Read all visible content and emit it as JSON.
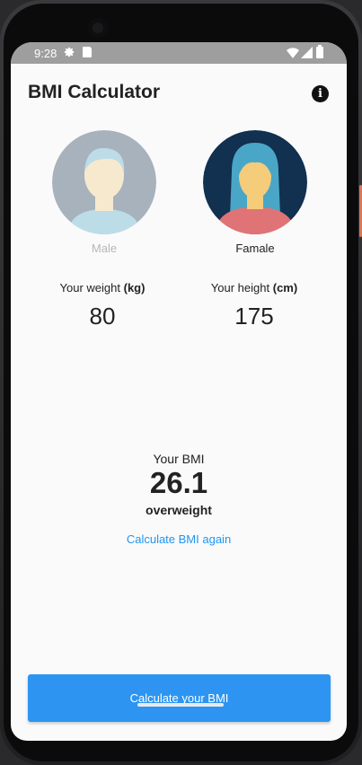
{
  "statusbar": {
    "time": "9:28",
    "icons": [
      "gear-icon",
      "sd-card-icon",
      "wifi-icon",
      "signal-icon",
      "battery-icon"
    ]
  },
  "app": {
    "title": "BMI Calculator",
    "info_icon": "info-icon"
  },
  "gender": {
    "male_label": "Male",
    "female_label": "Famale",
    "selected": "female"
  },
  "inputs": {
    "weight_label": "Your weight",
    "weight_unit": "(kg)",
    "weight_value": "80",
    "height_label": "Your height",
    "height_unit": "(cm)",
    "height_value": "175"
  },
  "result": {
    "title": "Your BMI",
    "value": "26.1",
    "status": "overweight",
    "again_link": "Calculate BMI again"
  },
  "button": {
    "label": "Calculate your BMI"
  },
  "colors": {
    "primary": "#2d95f1",
    "link": "#2196f3",
    "female_bg": "#12304f",
    "female_hair": "#4aa6c7",
    "female_shirt": "#e07375",
    "skin": "#f4cc7a"
  }
}
